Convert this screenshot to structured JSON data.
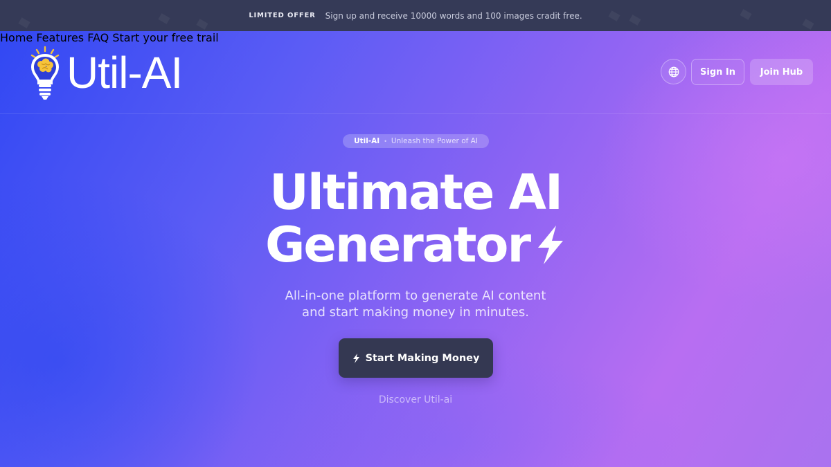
{
  "promo": {
    "tag": "LIMITED OFFER",
    "text": "Sign up and receive 10000 words and 100 images cradit free."
  },
  "brand": {
    "name": "Util-AI",
    "logo_icon": "lightbulb-brain-icon"
  },
  "nav": {
    "items": [
      "Home",
      "Features",
      "FAQ",
      "Start your free trail"
    ]
  },
  "header_actions": {
    "language_icon": "globe-icon",
    "sign_in": "Sign In",
    "join_hub": "Join Hub"
  },
  "hero": {
    "pill_brand": "Util-AI",
    "pill_tagline": "Unleash the Power of AI",
    "headline_line1": "Ultimate AI",
    "headline_line2": "Generator",
    "headline_icon": "lightning-bolt-icon",
    "subtitle_line1": "All-in-one platform to generate AI content",
    "subtitle_line2": "and start making money in minutes.",
    "cta_label": "Start Making Money",
    "cta_icon": "lightning-bolt-icon",
    "discover_link": "Discover Util-ai"
  },
  "colors": {
    "promo_bar": "#353a57",
    "gradient_start": "#2f47f3",
    "gradient_end": "#b86ef2",
    "cta_background": "#343852",
    "logo_bulb_yellow": "#f5c33b"
  }
}
